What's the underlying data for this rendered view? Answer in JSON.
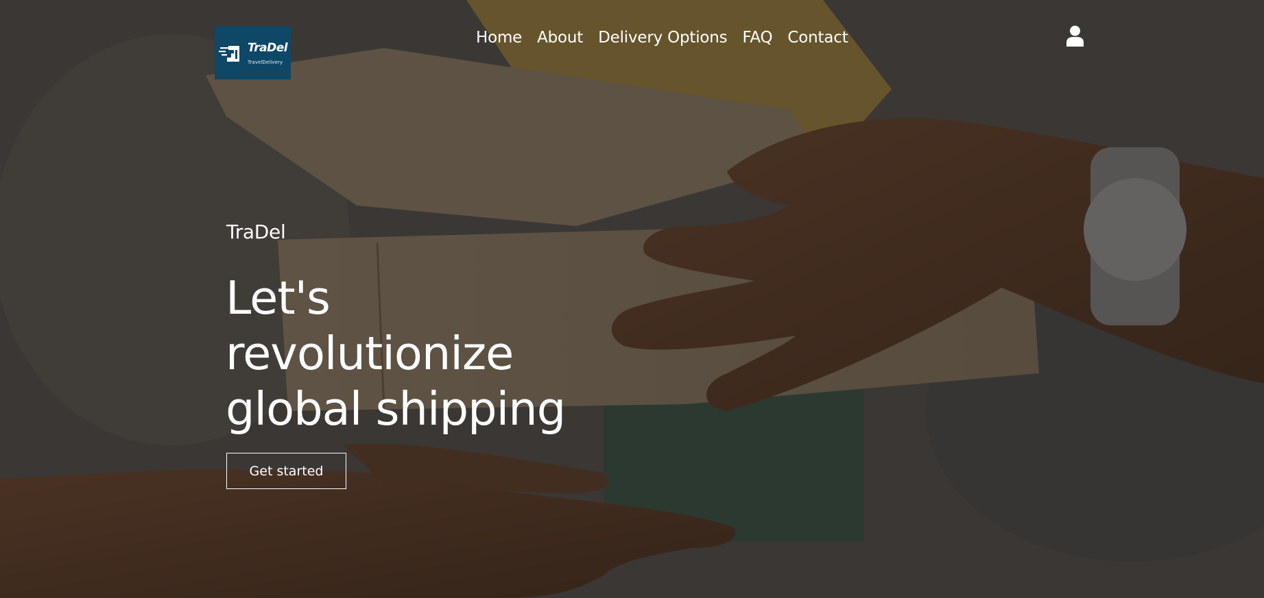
{
  "header": {
    "logo": {
      "name": "TraDel",
      "tagline": "TravelDelivery",
      "bg_color": "#0f4766"
    },
    "nav": [
      {
        "label": "Home"
      },
      {
        "label": "About"
      },
      {
        "label": "Delivery Options"
      },
      {
        "label": "FAQ"
      },
      {
        "label": "Contact"
      }
    ],
    "user_icon": "user-icon"
  },
  "hero": {
    "brand": "TraDel",
    "headline_lines": [
      "Let's",
      "revolutionize",
      "global shipping"
    ],
    "cta_label": "Get started",
    "text_color": "#ffffff"
  }
}
